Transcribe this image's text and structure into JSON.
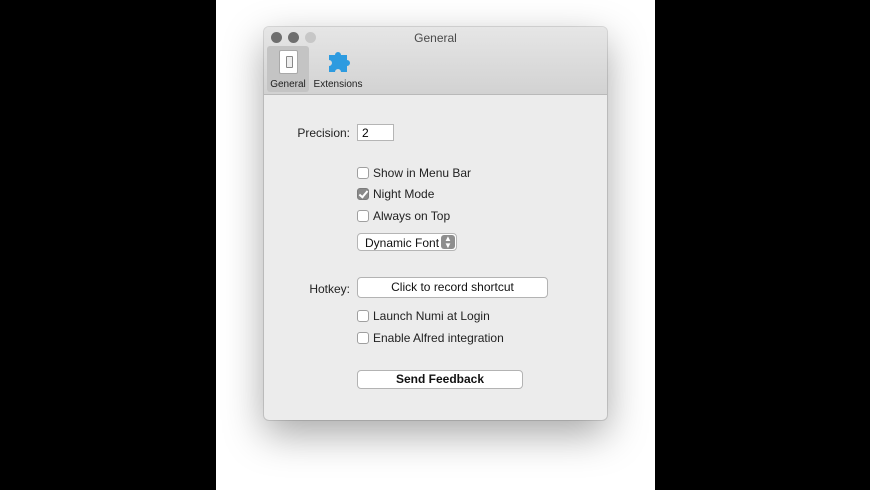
{
  "window": {
    "title": "General"
  },
  "toolbar": {
    "items": [
      {
        "label": "General",
        "icon": "switch-icon",
        "selected": true
      },
      {
        "label": "Extensions",
        "icon": "puzzle-icon",
        "selected": false
      }
    ]
  },
  "settings": {
    "precision_label": "Precision:",
    "precision_value": "2",
    "checkboxes": [
      {
        "label": "Show in Menu Bar",
        "checked": false
      },
      {
        "label": "Night Mode",
        "checked": true
      },
      {
        "label": "Always on Top",
        "checked": false
      }
    ],
    "font_popup": {
      "selected": "Dynamic Font",
      "icon": "up-down-chevron-icon"
    },
    "hotkey_label": "Hotkey:",
    "hotkey_button": "Click to record shortcut",
    "login_checkboxes": [
      {
        "label": "Launch Numi at Login",
        "checked": false
      },
      {
        "label": "Enable Alfred integration",
        "checked": false
      }
    ],
    "feedback_button": "Send Feedback"
  },
  "colors": {
    "puzzle_icon": "#2d9be0"
  }
}
